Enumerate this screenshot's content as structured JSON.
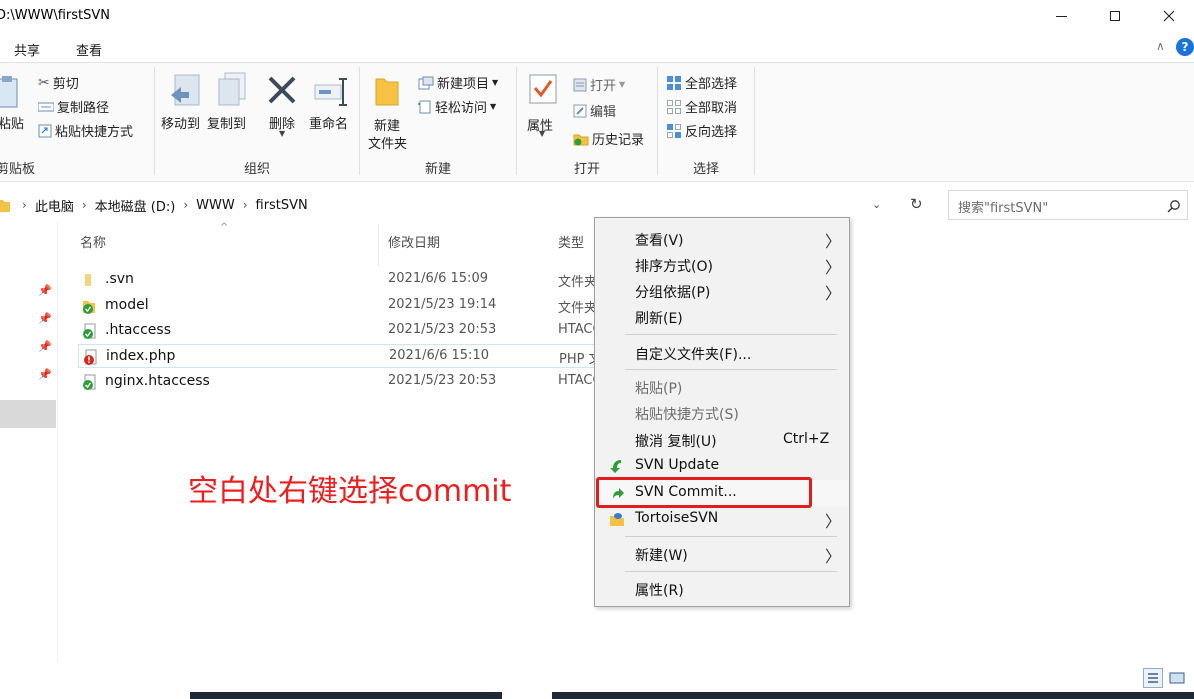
{
  "window": {
    "title": "D:\\WWW\\firstSVN",
    "minimize": "—",
    "maximize": "☐",
    "close": "✕"
  },
  "ribbon_tabs": [
    {
      "label": "共享"
    },
    {
      "label": "查看"
    }
  ],
  "ribbon": {
    "clipboard": {
      "paste": "粘贴",
      "cut": "剪切",
      "copy_path": "复制路径",
      "paste_shortcut": "粘贴快捷方式",
      "group": "剪贴板"
    },
    "organize": {
      "move_to": "移动到",
      "copy_to": "复制到",
      "delete": "删除",
      "rename": "重命名",
      "group": "组织"
    },
    "new": {
      "new_folder_line1": "新建",
      "new_folder_line2": "文件夹",
      "new_item": "新建项目",
      "easy_access": "轻松访问",
      "group": "新建"
    },
    "open": {
      "properties": "属性",
      "open": "打开",
      "edit": "编辑",
      "history": "历史记录",
      "group": "打开"
    },
    "select": {
      "select_all": "全部选择",
      "select_none": "全部取消",
      "invert": "反向选择",
      "group": "选择"
    }
  },
  "address": {
    "crumbs": [
      "此电脑",
      "本地磁盘 (D:)",
      "WWW",
      "firstSVN"
    ],
    "search_placeholder": "搜索\"firstSVN\""
  },
  "columns": {
    "name": "名称",
    "date": "修改日期",
    "type": "类型"
  },
  "files": [
    {
      "name": ".svn",
      "date": "2021/6/6 15:09",
      "type": "文件夹",
      "icon": "folder-icon"
    },
    {
      "name": "model",
      "date": "2021/5/23 19:14",
      "type": "文件夹",
      "icon": "svn-ok-folder-icon"
    },
    {
      "name": ".htaccess",
      "date": "2021/5/23 20:53",
      "type": "HTACCESS",
      "icon": "svn-ok-file-icon"
    },
    {
      "name": "index.php",
      "date": "2021/6/6 15:10",
      "type": "PHP 文件",
      "icon": "svn-modified-file-icon"
    },
    {
      "name": "nginx.htaccess",
      "date": "2021/5/23 20:53",
      "type": "HTACCESS",
      "icon": "svn-ok-file-icon"
    }
  ],
  "annotation": "空白处右键选择commit",
  "context_menu": {
    "view": "查看(V)",
    "sort": "排序方式(O)",
    "group": "分组依据(P)",
    "refresh": "刷新(E)",
    "customize": "自定义文件夹(F)...",
    "paste": "粘贴(P)",
    "paste_shortcut": "粘贴快捷方式(S)",
    "undo": "撤消 复制(U)",
    "undo_shortcut": "Ctrl+Z",
    "svn_update": "SVN Update",
    "svn_commit": "SVN Commit...",
    "tortoise": "TortoiseSVN",
    "new": "新建(W)",
    "properties": "属性(R)"
  },
  "colors": {
    "annotation": "#ef1e1e",
    "highlight_box": "#e21d1d",
    "svn_green": "#2e9e3a",
    "svn_red": "#d8281e"
  }
}
